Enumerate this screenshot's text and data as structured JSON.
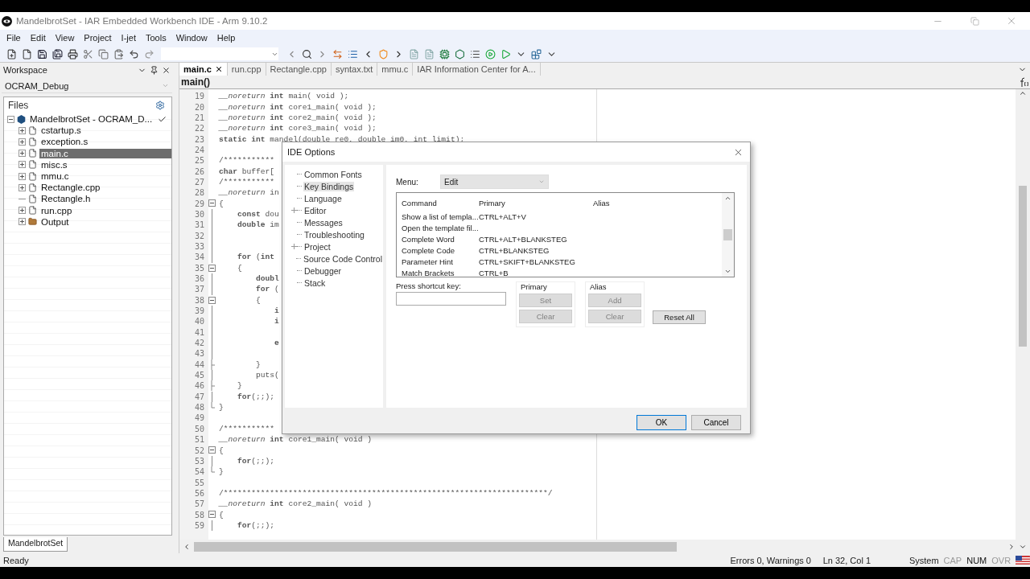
{
  "window": {
    "title": "MandelbrotSet - IAR Embedded Workbench IDE - Arm 9.10.2"
  },
  "menu": [
    "File",
    "Edit",
    "View",
    "Project",
    "I-jet",
    "Tools",
    "Window",
    "Help"
  ],
  "workspace": {
    "title": "Workspace",
    "configuration": "OCRAM_Debug",
    "files_title": "Files",
    "tree": [
      {
        "label": "MandelbrotSet - OCRAM_D...",
        "kind": "project",
        "expanded": true,
        "checked": true,
        "selected": false,
        "children": [
          {
            "label": "cstartup.s",
            "kind": "file",
            "expandable": true,
            "selected": false
          },
          {
            "label": "exception.s",
            "kind": "file",
            "expandable": true,
            "selected": false
          },
          {
            "label": "main.c",
            "kind": "file",
            "expandable": true,
            "selected": true
          },
          {
            "label": "misc.s",
            "kind": "file",
            "expandable": true,
            "selected": false
          },
          {
            "label": "mmu.c",
            "kind": "file",
            "expandable": true,
            "selected": false
          },
          {
            "label": "Rectangle.cpp",
            "kind": "file",
            "expandable": true,
            "selected": false
          },
          {
            "label": "Rectangle.h",
            "kind": "file",
            "expandable": false,
            "selected": false
          },
          {
            "label": "run.cpp",
            "kind": "file",
            "expandable": true,
            "selected": false
          },
          {
            "label": "Output",
            "kind": "folder",
            "expandable": true,
            "selected": false
          }
        ]
      }
    ],
    "bottom_tab": "MandelbrotSet"
  },
  "editor": {
    "tabs": [
      {
        "label": "main.c",
        "selected": true,
        "closable": true
      },
      {
        "label": "run.cpp",
        "selected": false,
        "closable": false
      },
      {
        "label": "Rectangle.cpp",
        "selected": false,
        "closable": false
      },
      {
        "label": "syntax.txt",
        "selected": false,
        "closable": false
      },
      {
        "label": "mmu.c",
        "selected": false,
        "closable": false
      },
      {
        "label": "IAR Information Center for A...",
        "selected": false,
        "closable": false
      }
    ],
    "function": "main()",
    "lines": [
      {
        "no": "19",
        "kind": "plain",
        "text": "*__noreturn* **int** main( void );"
      },
      {
        "no": "20",
        "kind": "plain",
        "text": "*__noreturn* **int** core1_main( void );"
      },
      {
        "no": "21",
        "kind": "plain",
        "text": "*__noreturn* **int** core2_main( void );"
      },
      {
        "no": "22",
        "kind": "plain",
        "text": "*__noreturn* **int** core3_main( void );"
      },
      {
        "no": "23",
        "kind": "plain",
        "text": "**static** **int** mandel(double re0, double im0, int limit);"
      },
      {
        "no": "24",
        "kind": "plain"
      },
      {
        "no": "25",
        "kind": "comment",
        "text": "/***********"
      },
      {
        "no": "26",
        "kind": "plain",
        "text": "**char** buffer["
      },
      {
        "no": "27",
        "kind": "comment",
        "text": "/***********"
      },
      {
        "no": "28",
        "kind": "plain",
        "text": "*__noreturn* in"
      },
      {
        "no": "29",
        "kind": "fold-start",
        "text": "{"
      },
      {
        "no": "30",
        "kind": "fold-line",
        "text": "    **const** dou"
      },
      {
        "no": "31",
        "kind": "fold-line",
        "text": "    **double** im"
      },
      {
        "no": "32",
        "kind": "fold-line"
      },
      {
        "no": "33",
        "kind": "fold-line"
      },
      {
        "no": "34",
        "kind": "fold-line",
        "text": "    **for** (**int**"
      },
      {
        "no": "35",
        "kind": "fold-start",
        "text": "    {"
      },
      {
        "no": "36",
        "kind": "fold-line",
        "text": "        **doubl**"
      },
      {
        "no": "37",
        "kind": "fold-line",
        "text": "        **for** ("
      },
      {
        "no": "38",
        "kind": "fold-start",
        "text": "        {"
      },
      {
        "no": "39",
        "kind": "fold-line",
        "text": "            **i**"
      },
      {
        "no": "40",
        "kind": "fold-line",
        "text": "            **i**"
      },
      {
        "no": "41",
        "kind": "fold-line"
      },
      {
        "no": "42",
        "kind": "fold-line",
        "text": "            **e**"
      },
      {
        "no": "43",
        "kind": "fold-line"
      },
      {
        "no": "44",
        "kind": "fold-branch",
        "text": "        }"
      },
      {
        "no": "45",
        "kind": "fold-line",
        "text": "        puts("
      },
      {
        "no": "46",
        "kind": "fold-branch",
        "text": "    }"
      },
      {
        "no": "47",
        "kind": "fold-line",
        "text": "    **for**(;;);"
      },
      {
        "no": "48",
        "kind": "fold-end",
        "text": "}"
      },
      {
        "no": "49",
        "kind": "plain"
      },
      {
        "no": "50",
        "kind": "comment",
        "text": "/***********"
      },
      {
        "no": "51",
        "kind": "plain",
        "text": "*__noreturn* **int** core1_main( void )"
      },
      {
        "no": "52",
        "kind": "fold-start",
        "text": "{"
      },
      {
        "no": "53",
        "kind": "fold-line",
        "text": "    **for**(;;);"
      },
      {
        "no": "54",
        "kind": "fold-end",
        "text": "}"
      },
      {
        "no": "55",
        "kind": "plain"
      },
      {
        "no": "56",
        "kind": "comment",
        "text": "/**********************************************************************/"
      },
      {
        "no": "57",
        "kind": "plain",
        "text": "*__noreturn* **int** core2_main( void )"
      },
      {
        "no": "58",
        "kind": "fold-start",
        "text": "{"
      },
      {
        "no": "59",
        "kind": "fold-line",
        "text": "    **for**(;;);"
      }
    ]
  },
  "dialog": {
    "title": "IDE Options",
    "nav": [
      {
        "label": "Common Fonts",
        "expandable": false,
        "selected": false
      },
      {
        "label": "Key Bindings",
        "expandable": false,
        "selected": true
      },
      {
        "label": "Language",
        "expandable": false,
        "selected": false
      },
      {
        "label": "Editor",
        "expandable": true,
        "selected": false
      },
      {
        "label": "Messages",
        "expandable": false,
        "selected": false
      },
      {
        "label": "Troubleshooting",
        "expandable": false,
        "selected": false
      },
      {
        "label": "Project",
        "expandable": true,
        "selected": false
      },
      {
        "label": "Source Code Control",
        "expandable": false,
        "selected": false
      },
      {
        "label": "Debugger",
        "expandable": false,
        "selected": false
      },
      {
        "label": "Stack",
        "expandable": false,
        "selected": false
      }
    ],
    "menu_label": "Menu:",
    "menu_value": "Edit",
    "columns": [
      "Command",
      "Primary",
      "Alias"
    ],
    "rows": [
      {
        "command": "Show a list of templa...",
        "primary": "CTRL+ALT+V"
      },
      {
        "command": "Open the template fil..."
      },
      {
        "command": "Complete Word",
        "primary": "CTRL+ALT+BLANKSTEG"
      },
      {
        "command": "Complete Code",
        "primary": "CTRL+BLANKSTEG"
      },
      {
        "command": "Parameter Hint",
        "primary": "CTRL+SKIFT+BLANKSTEG"
      },
      {
        "command": "Match Brackets",
        "primary": "CTRL+B"
      }
    ],
    "shortcut_label": "Press shortcut key:",
    "groups": [
      {
        "title": "Primary",
        "buttons": [
          {
            "label": "Set",
            "disabled": true
          },
          {
            "label": "Clear",
            "disabled": true
          }
        ]
      },
      {
        "title": "Alias",
        "buttons": [
          {
            "label": "Add",
            "disabled": true
          },
          {
            "label": "Clear",
            "disabled": true
          }
        ]
      }
    ],
    "reset_button": "Reset All",
    "ok_button": "OK",
    "cancel_button": "Cancel"
  },
  "status_bar": {
    "message": "Ready",
    "diagnostics": "Errors 0, Warnings 0",
    "position": "Ln 32, Col 1",
    "mode": "System",
    "indicators": [
      {
        "label": "CAP",
        "on": false
      },
      {
        "label": "NUM",
        "on": true
      },
      {
        "label": "OVR",
        "on": false
      }
    ]
  }
}
